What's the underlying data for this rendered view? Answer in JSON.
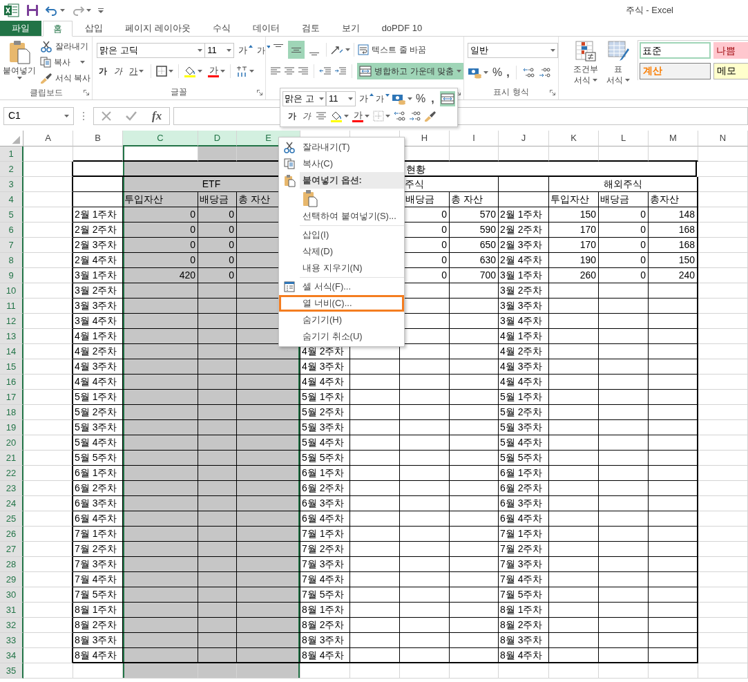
{
  "title_bar": {
    "title": "주식 - Excel"
  },
  "tabs": [
    {
      "label": "파일",
      "kind": "file",
      "selected": false
    },
    {
      "label": "홈",
      "kind": "tab",
      "selected": true
    },
    {
      "label": "삽입",
      "kind": "tab",
      "selected": false
    },
    {
      "label": "페이지 레이아웃",
      "kind": "tab",
      "selected": false
    },
    {
      "label": "수식",
      "kind": "tab",
      "selected": false
    },
    {
      "label": "데이터",
      "kind": "tab",
      "selected": false
    },
    {
      "label": "검토",
      "kind": "tab",
      "selected": false
    },
    {
      "label": "보기",
      "kind": "tab",
      "selected": false
    },
    {
      "label": "doPDF 10",
      "kind": "tab",
      "selected": false
    }
  ],
  "ribbon": {
    "clipboard": {
      "paste": "붙여넣기",
      "cut": "잘라내기",
      "copy": "복사",
      "format_painter": "서식 복사",
      "label": "클립보드"
    },
    "font": {
      "font_name": "맑은 고딕",
      "font_size": "11",
      "grow": "가",
      "shrink": "가",
      "bold": "가",
      "italic": "가",
      "underline": "가",
      "font_color": "가",
      "label": "글꼴"
    },
    "alignment": {
      "vertical_align": [
        {
          "selected": false
        },
        {
          "selected": true
        },
        {
          "selected": false
        }
      ],
      "wrap_text": "텍스트 줄 바꿈",
      "merge_center": {
        "label": "병합하고 가운데 맞춤",
        "on": true
      }
    },
    "number": {
      "format": "일반",
      "percent": "%",
      "comma": ",",
      "label": "표시 형식"
    },
    "styles": {
      "conditional": [
        "조건부",
        "서식"
      ],
      "table_format": [
        "표",
        "서식"
      ],
      "gallery": [
        {
          "label": "표준",
          "kind": "normal",
          "selected": true
        },
        {
          "label": "나쁨",
          "kind": "bad",
          "selected": false
        },
        {
          "label": "계산",
          "kind": "calculation",
          "selected": false
        },
        {
          "label": "메모",
          "kind": "note",
          "selected": false
        }
      ]
    }
  },
  "formula_bar": {
    "name_box": "C1",
    "function_label": "fx"
  },
  "mini_toolbar": {
    "font_name": "맑은 고",
    "font_size": "11",
    "grow": "가",
    "shrink": "가",
    "percent": "%",
    "comma": ",",
    "bold": "가",
    "italic": "가",
    "font_color": "가"
  },
  "context_menu": [
    {
      "kind": "cut",
      "label": "잘라내기(T)",
      "highlighted": false
    },
    {
      "kind": "copy",
      "label": "복사(C)",
      "highlighted": false
    },
    {
      "kind": "paste_header",
      "label": "붙여넣기 옵션:",
      "highlighted": false
    },
    {
      "kind": "paste_button",
      "highlighted": false
    },
    {
      "kind": "command",
      "label": "선택하여 붙여넣기(S)...",
      "highlighted": false
    },
    {
      "kind": "separator"
    },
    {
      "kind": "command",
      "label": "삽입(I)",
      "highlighted": false
    },
    {
      "kind": "command",
      "label": "삭제(D)",
      "highlighted": false
    },
    {
      "kind": "command",
      "label": "내용 지우기(N)",
      "highlighted": false
    },
    {
      "kind": "separator"
    },
    {
      "kind": "format_cells",
      "label": "셀 서식(F)...",
      "highlighted": false
    },
    {
      "kind": "command",
      "label": "열 너비(C)...",
      "highlighted": true
    },
    {
      "kind": "command",
      "label": "숨기기(H)",
      "highlighted": false
    },
    {
      "kind": "command",
      "label": "숨기기 취소(U)",
      "highlighted": false
    }
  ],
  "sheet": {
    "columns": [
      {
        "label": "A",
        "selected": false
      },
      {
        "label": "B",
        "selected": false
      },
      {
        "label": "C",
        "selected": true
      },
      {
        "label": "D",
        "selected": true
      },
      {
        "label": "E",
        "selected": true
      },
      {
        "selected": false
      },
      {
        "selected": false
      },
      {
        "label": "H",
        "selected": false
      },
      {
        "label": "I",
        "selected": false
      },
      {
        "label": "J",
        "selected": false
      },
      {
        "label": "K",
        "selected": false
      },
      {
        "label": "L",
        "selected": false
      },
      {
        "label": "M",
        "selected": false
      },
      {
        "label": "N",
        "selected": false
      }
    ],
    "rows": [
      {
        "label": "1"
      },
      {
        "label": "2",
        "cells": {
          "B": "현황"
        }
      },
      {
        "label": "3",
        "cells": {
          "C": "ETF",
          "F": "주식",
          "K": "해외주식"
        }
      },
      {
        "label": "4",
        "cells": {
          "C": "투입자산",
          "D": "배당금",
          "E": "총 자산",
          "H": "배당금",
          "I": "총 자산",
          "K": "투입자산",
          "L": "배당금",
          "M": "총자산"
        }
      },
      {
        "label": "5",
        "cells": {
          "B": "2월 1주차",
          "C": "0",
          "D": "0",
          "H": "0",
          "I": "570",
          "J": "2월 1주차",
          "K": "150",
          "L": "0",
          "M": "148"
        }
      },
      {
        "label": "6",
        "cells": {
          "B": "2월 2주차",
          "C": "0",
          "D": "0",
          "H": "0",
          "I": "590",
          "J": "2월 2주차",
          "K": "170",
          "L": "0",
          "M": "168"
        }
      },
      {
        "label": "7",
        "cells": {
          "B": "2월 3주차",
          "C": "0",
          "D": "0",
          "H": "0",
          "I": "650",
          "J": "2월 3주차",
          "K": "170",
          "L": "0",
          "M": "168"
        }
      },
      {
        "label": "8",
        "cells": {
          "B": "2월 4주차",
          "C": "0",
          "D": "0",
          "H": "0",
          "I": "630",
          "J": "2월 4주차",
          "K": "190",
          "L": "0",
          "M": "150"
        }
      },
      {
        "label": "9",
        "cells": {
          "B": "3월 1주차",
          "C": "420",
          "D": "0",
          "H": "0",
          "I": "700",
          "J": "3월 1주차",
          "K": "260",
          "L": "0",
          "M": "240"
        }
      },
      {
        "label": "10",
        "cells": {
          "B": "3월 2주차",
          "J": "3월 2주차"
        }
      },
      {
        "label": "11",
        "cells": {
          "B": "3월 3주차",
          "J": "3월 3주차"
        }
      },
      {
        "label": "12",
        "cells": {
          "B": "3월 4주차",
          "J": "3월 4주차"
        }
      },
      {
        "label": "13",
        "cells": {
          "B": "4월 1주차",
          "J": "4월 1주차"
        }
      },
      {
        "label": "14",
        "cells": {
          "B": "4월 2주차",
          "F": "4월 2주차",
          "J": "4월 2주차"
        }
      },
      {
        "label": "15",
        "cells": {
          "B": "4월 3주차",
          "F": "4월 3주차",
          "J": "4월 3주차"
        }
      },
      {
        "label": "16",
        "cells": {
          "B": "4월 4주차",
          "F": "4월 4주차",
          "J": "4월 4주차"
        }
      },
      {
        "label": "17",
        "cells": {
          "B": "5월 1주차",
          "F": "5월 1주차",
          "J": "5월 1주차"
        }
      },
      {
        "label": "18",
        "cells": {
          "B": "5월 2주차",
          "F": "5월 2주차",
          "J": "5월 2주차"
        }
      },
      {
        "label": "19",
        "cells": {
          "B": "5월 3주차",
          "F": "5월 3주차",
          "J": "5월 3주차"
        }
      },
      {
        "label": "20",
        "cells": {
          "B": "5월 4주차",
          "F": "5월 4주차",
          "J": "5월 4주차"
        }
      },
      {
        "label": "21",
        "cells": {
          "B": "5월 5주차",
          "F": "5월 5주차",
          "J": "5월 5주차"
        }
      },
      {
        "label": "22",
        "cells": {
          "B": "6월 1주차",
          "F": "6월 1주차",
          "J": "6월 1주차"
        }
      },
      {
        "label": "23",
        "cells": {
          "B": "6월 2주차",
          "F": "6월 2주차",
          "J": "6월 2주차"
        }
      },
      {
        "label": "24",
        "cells": {
          "B": "6월 3주차",
          "F": "6월 3주차",
          "J": "6월 3주차"
        }
      },
      {
        "label": "25",
        "cells": {
          "B": "6월 4주차",
          "F": "6월 4주차",
          "J": "6월 4주차"
        }
      },
      {
        "label": "26",
        "cells": {
          "B": "7월 1주차",
          "F": "7월 1주차",
          "J": "7월 1주차"
        }
      },
      {
        "label": "27",
        "cells": {
          "B": "7월 2주차",
          "F": "7월 2주차",
          "J": "7월 2주차"
        }
      },
      {
        "label": "28",
        "cells": {
          "B": "7월 3주차",
          "F": "7월 3주차",
          "J": "7월 3주차"
        }
      },
      {
        "label": "29",
        "cells": {
          "B": "7월 4주차",
          "F": "7월 4주차",
          "J": "7월 4주차"
        }
      },
      {
        "label": "30",
        "cells": {
          "B": "7월 5주차",
          "F": "7월 5주차",
          "J": "7월 5주차"
        }
      },
      {
        "label": "31",
        "cells": {
          "B": "8월 1주차",
          "F": "8월 1주차",
          "J": "8월 1주차"
        }
      },
      {
        "label": "32",
        "cells": {
          "B": "8월 2주차",
          "F": "8월 2주차",
          "J": "8월 2주차"
        }
      },
      {
        "label": "33",
        "cells": {
          "B": "8월 3주차",
          "F": "8월 3주차",
          "J": "8월 3주차"
        }
      },
      {
        "label": "34",
        "cells": {
          "B": "8월 4주차",
          "F": "8월 4주차",
          "J": "8월 4주차"
        }
      },
      {
        "label": "35"
      }
    ]
  }
}
